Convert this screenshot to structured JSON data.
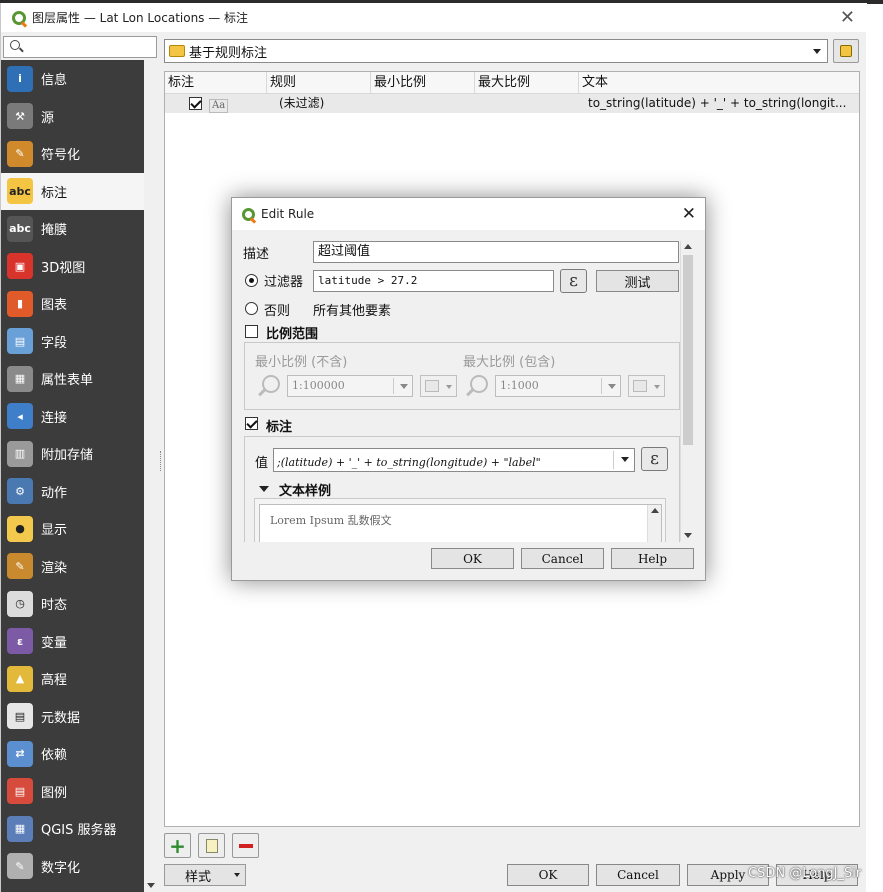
{
  "window": {
    "title": "图层属性 — Lat Lon Locations — 标注",
    "close": "✕"
  },
  "search": {
    "placeholder": ""
  },
  "sidebar": {
    "items": [
      {
        "label": "信息",
        "icon": "info-icon",
        "color": "#2f6fb5"
      },
      {
        "label": "源",
        "icon": "source-wrench-icon",
        "color": "#7a7a7a"
      },
      {
        "label": "符号化",
        "icon": "symbology-brush-icon",
        "color": "#d08a2c"
      },
      {
        "label": "标注",
        "icon": "labels-abc-icon",
        "color": "#f4c542"
      },
      {
        "label": "掩膜",
        "icon": "mask-abc-icon",
        "color": "#555555"
      },
      {
        "label": "3D视图",
        "icon": "cube-3d-icon",
        "color": "#d9342b"
      },
      {
        "label": "图表",
        "icon": "diagram-chart-icon",
        "color": "#e05a2a"
      },
      {
        "label": "字段",
        "icon": "fields-table-icon",
        "color": "#6aa0d8"
      },
      {
        "label": "属性表单",
        "icon": "attribute-form-icon",
        "color": "#8a8a8a"
      },
      {
        "label": "连接",
        "icon": "joins-icon",
        "color": "#3f7ec9"
      },
      {
        "label": "附加存储",
        "icon": "auxiliary-storage-icon",
        "color": "#9a9a9a"
      },
      {
        "label": "动作",
        "icon": "actions-gear-icon",
        "color": "#4a78b0"
      },
      {
        "label": "显示",
        "icon": "display-speech-icon",
        "color": "#f2c94c"
      },
      {
        "label": "渲染",
        "icon": "rendering-brush-icon",
        "color": "#c9892e"
      },
      {
        "label": "时态",
        "icon": "temporal-clock-icon",
        "color": "#dcdcdc"
      },
      {
        "label": "变量",
        "icon": "variables-epsilon-icon",
        "color": "#7d5aa6"
      },
      {
        "label": "高程",
        "icon": "elevation-icon",
        "color": "#e2b93b"
      },
      {
        "label": "元数据",
        "icon": "metadata-icon",
        "color": "#e6e6e6"
      },
      {
        "label": "依赖",
        "icon": "dependencies-icon",
        "color": "#5c8fd0"
      },
      {
        "label": "图例",
        "icon": "legend-icon",
        "color": "#d64b3b"
      },
      {
        "label": "QGIS 服务器",
        "icon": "qgis-server-icon",
        "color": "#5b7db8"
      },
      {
        "label": "数字化",
        "icon": "digitizing-icon",
        "color": "#b0b0b0"
      }
    ]
  },
  "mode": {
    "label": "基于规则标注"
  },
  "rules_table": {
    "columns": [
      "标注",
      "规则",
      "最小比例",
      "最大比例",
      "文本"
    ],
    "rows": [
      {
        "checked": true,
        "sample": "Aa",
        "rule": "(未过滤)",
        "min": "",
        "max": "",
        "text": "to_string(latitude)  + '_' +   to_string(longit..."
      }
    ]
  },
  "bottom": {
    "style": "样式",
    "ok": "OK",
    "cancel": "Cancel",
    "apply": "Apply",
    "help": "Help"
  },
  "watermark": "CSDN @LongJ_Sir",
  "edit_rule": {
    "title": "Edit Rule",
    "close": "✕",
    "desc_label": "描述",
    "desc_value": "超过阈值",
    "filter_label": "过滤器",
    "filter_value": "latitude > 27.2",
    "epsilon": "ε",
    "test_label": "测试",
    "else_label": "否则",
    "else_value": "所有其他要素",
    "scale_label": "比例范围",
    "min_scale_label": "最小比例 (不含)",
    "min_scale_value": "1:100000",
    "max_scale_label": "最大比例 (包含)",
    "max_scale_value": "1:1000",
    "labels_label": "标注",
    "value_label": "值",
    "value_expr": ";(latitude) + '_' +   to_string(longitude) +  \"label\"",
    "text_sample_label": "文本样例",
    "text_sample": "Lorem Ipsum 乱数假文",
    "ok": "OK",
    "cancel": "Cancel",
    "help": "Help"
  }
}
